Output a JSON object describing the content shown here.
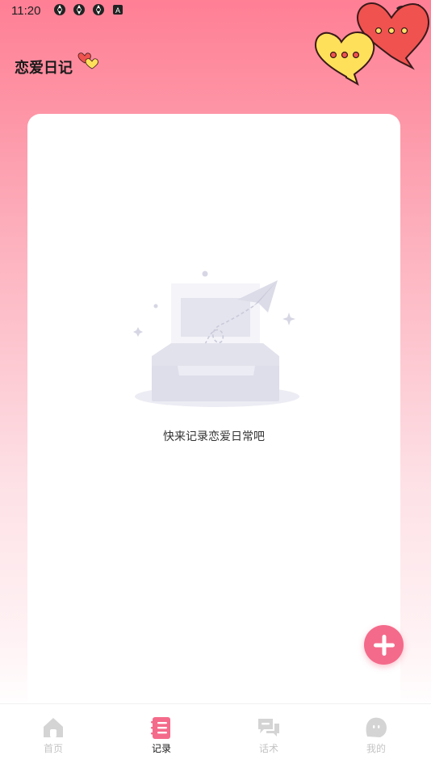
{
  "status_bar": {
    "time": "11:20"
  },
  "header": {
    "title": "恋爱日记"
  },
  "empty_state": {
    "message": "快来记录恋爱日常吧"
  },
  "fab": {
    "icon": "plus-icon"
  },
  "tabbar": {
    "active_color": "#f46a8a",
    "items": [
      {
        "label": "首页",
        "icon": "home-icon",
        "active": false
      },
      {
        "label": "记录",
        "icon": "record-icon",
        "active": true
      },
      {
        "label": "话术",
        "icon": "chat-icon",
        "active": false
      },
      {
        "label": "我的",
        "icon": "profile-icon",
        "active": false
      }
    ]
  }
}
